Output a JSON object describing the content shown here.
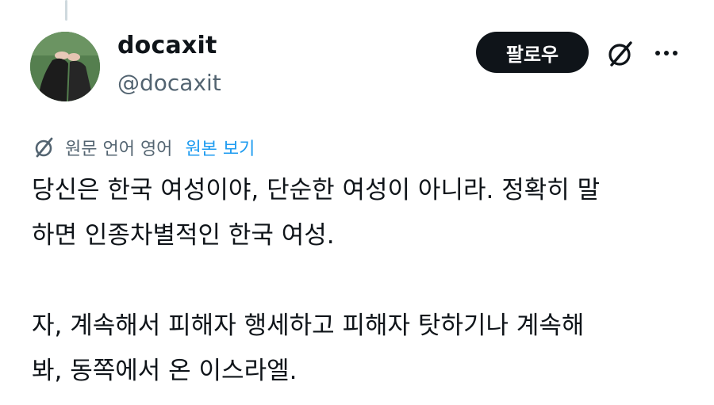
{
  "author": {
    "display_name": "docaxit",
    "handle": "@docaxit"
  },
  "actions": {
    "follow_label": "팔로우",
    "grok_icon": "grok-slash-icon",
    "more_icon": "more-horizontal-icon"
  },
  "translation": {
    "icon": "grok-translate-icon",
    "note": "원문 언어 영어",
    "show_original_label": "원본 보기"
  },
  "tweet": {
    "text": "당신은 한국 여성이야, 단순한 여성이 아니라. 정확히 말\n하면 인종차별적인 한국 여성.\n\n자, 계속해서 피해자 행세하고 피해자 탓하기나 계속해\n봐, 동쪽에서 온 이스라엘."
  },
  "colors": {
    "primary_text": "#0f1419",
    "secondary_text": "#536471",
    "link": "#1d9bf0",
    "follow_bg": "#0f1419",
    "follow_text": "#ffffff"
  }
}
